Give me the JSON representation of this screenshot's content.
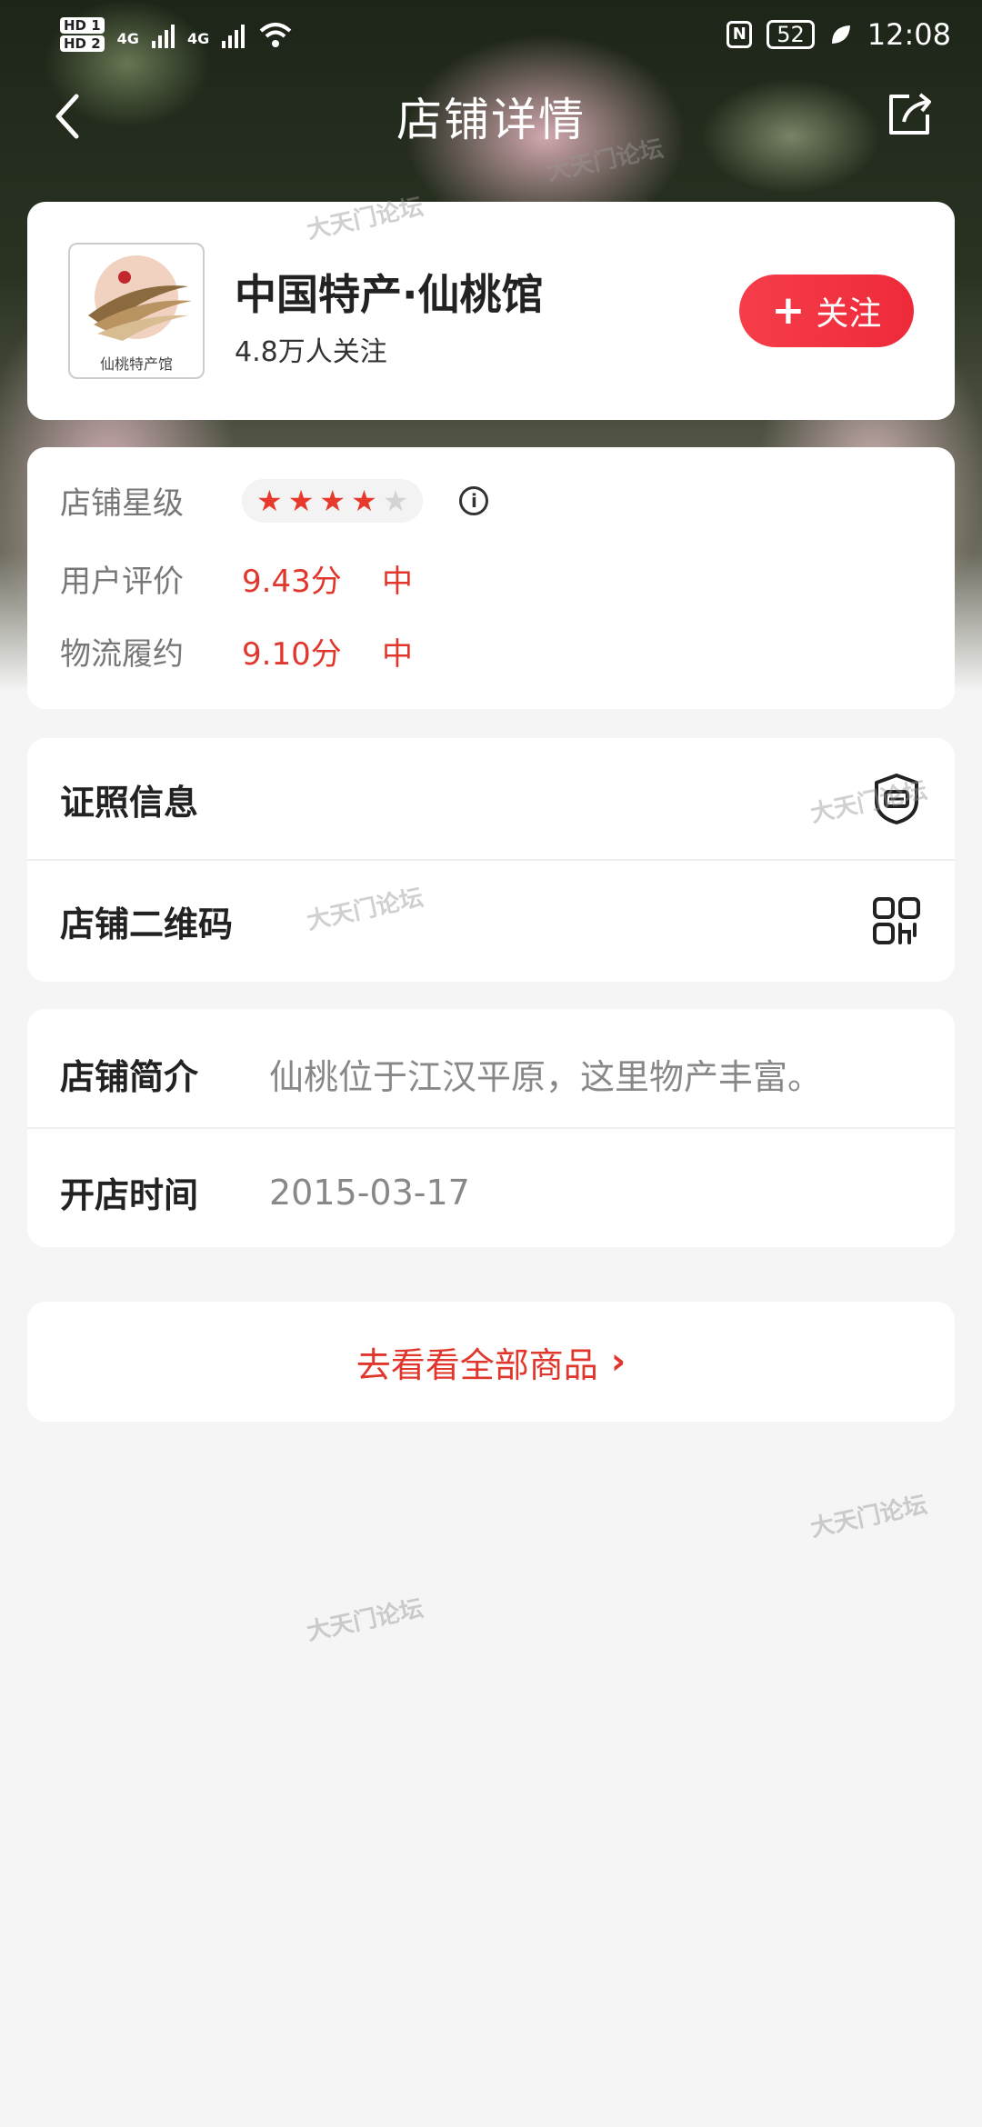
{
  "status_bar": {
    "hd1": "HD 1",
    "hd2": "HD 2",
    "net1": "4G",
    "net2": "4G",
    "nfc": "N",
    "battery": "52",
    "time": "12:08"
  },
  "nav": {
    "title": "店铺详情",
    "back_icon": "back-chevron-icon",
    "share_icon": "share-icon"
  },
  "shop": {
    "logo_caption": "仙桃特产馆",
    "name": "中国特产·仙桃馆",
    "followers": "4.8万人关注",
    "follow_label": "关注",
    "follow_icon": "plus-icon"
  },
  "ratings": {
    "star_label": "店铺星级",
    "stars": 4,
    "stars_max": 5,
    "user_label": "用户评价",
    "user_score": "9.43分",
    "user_level": "中",
    "logistics_label": "物流履约",
    "logistics_score": "9.10分",
    "logistics_level": "中"
  },
  "license": {
    "license_label": "证照信息",
    "license_icon": "license-shield-icon",
    "qr_label": "店铺二维码",
    "qr_icon": "qr-code-icon"
  },
  "intro": {
    "intro_label": "店铺简介",
    "intro_value": "仙桃位于江汉平原，这里物产丰富。",
    "open_label": "开店时间",
    "open_value": "2015-03-17"
  },
  "all_goods": {
    "label": "去看看全部商品",
    "chevron": "›"
  },
  "watermark": "大天门论坛",
  "colors": {
    "accent_red": "#e0362c",
    "follow_red": "#f63d4a"
  }
}
